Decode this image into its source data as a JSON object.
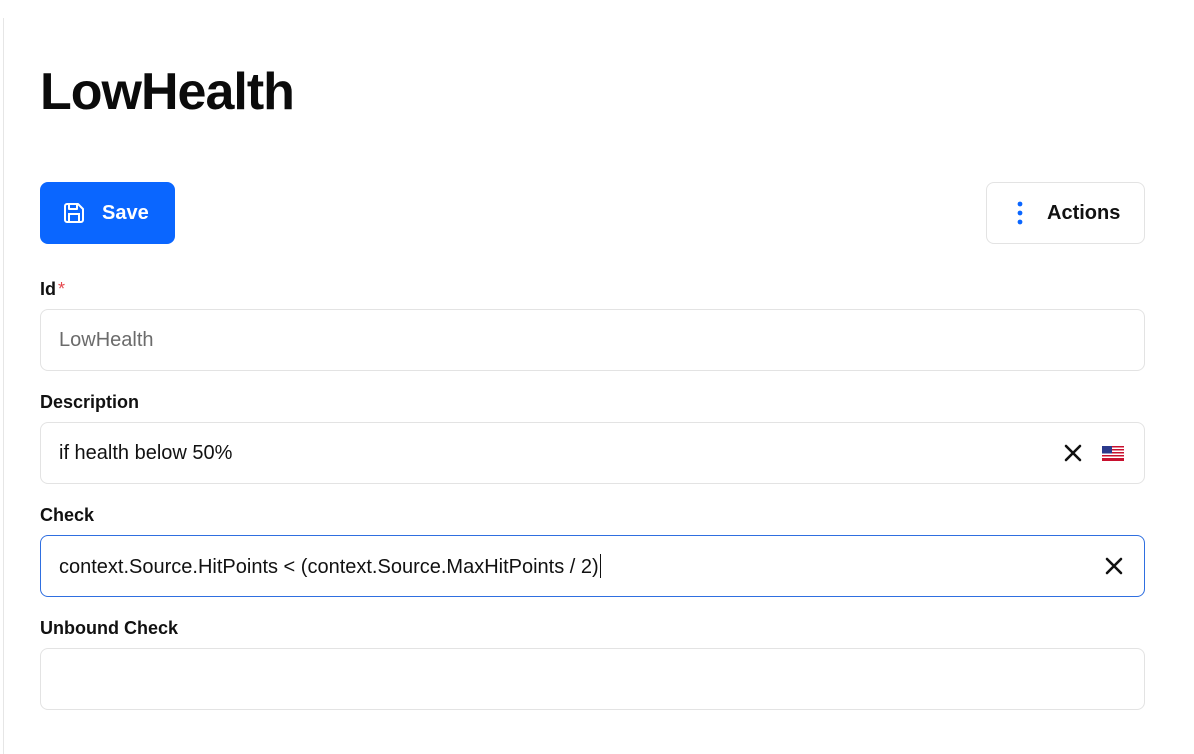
{
  "page": {
    "title": "LowHealth"
  },
  "toolbar": {
    "save_label": "Save",
    "save_icon": "floppy-disk-icon",
    "actions_label": "Actions",
    "actions_icon": "vertical-dots-icon"
  },
  "form": {
    "id": {
      "label": "Id",
      "required_marker": "*",
      "value": "LowHealth"
    },
    "description": {
      "label": "Description",
      "value": "if health below 50%",
      "clear_icon": "close-icon",
      "language_icon": "us-flag-icon"
    },
    "check": {
      "label": "Check",
      "value": "context.Source.HitPoints < (context.Source.MaxHitPoints / 2)",
      "clear_icon": "close-icon"
    },
    "unbound_check": {
      "label": "Unbound Check",
      "value": ""
    }
  },
  "colors": {
    "accent": "#0a66ff",
    "focus_border": "#2f6fe0",
    "required": "#e5484d",
    "border": "#e3e3e3"
  }
}
